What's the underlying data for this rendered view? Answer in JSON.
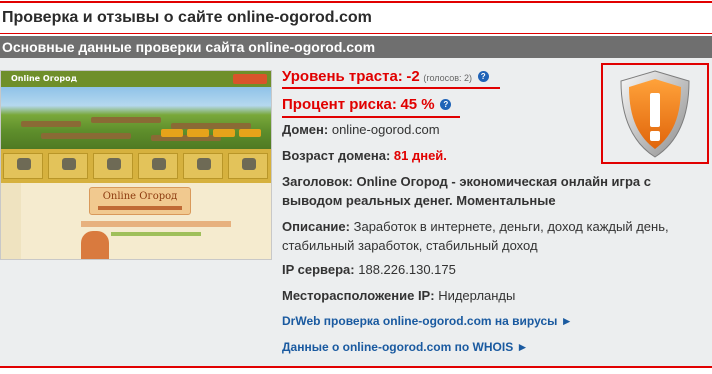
{
  "page": {
    "title": "Проверка и отзывы о сайте online-ogorod.com",
    "section_title": "Основные данные проверки сайта online-ogorod.com"
  },
  "thumbnail": {
    "logo_text": "Online Огород",
    "banner_text": "Online Огород"
  },
  "trust": {
    "label": "Уровень траста:",
    "value": "-2",
    "votes": "(голосов: 2)"
  },
  "risk": {
    "label": "Процент риска:",
    "value": "45 %"
  },
  "help_icon_glyph": "?",
  "domain": {
    "label": "Домен:",
    "value": "online-ogorod.com"
  },
  "age": {
    "label": "Возраст домена:",
    "value": "81 дней."
  },
  "heading": {
    "label": "Заголовок:",
    "value": "Online Огород - экономическая онлайн игра с выводом реальных денег. Моментальные"
  },
  "description": {
    "label": "Описание:",
    "value": "Заработок в интернете, деньги, доход каждый день, стабильный заработок, стабильный доход"
  },
  "ip": {
    "label": "IP сервера:",
    "value": "188.226.130.175"
  },
  "location": {
    "label": "Месторасположение IP:",
    "value": "Нидерланды"
  },
  "links": {
    "drweb": "DrWeb проверка online-ogorod.com на вирусы ►",
    "whois": "Данные о online-ogorod.com по WHOIS ►"
  },
  "colors": {
    "accent_red": "#e10000",
    "link_blue": "#1a5aa0",
    "section_bar": "#6f6f6f",
    "shield_orange": "#f07d12"
  },
  "icons": {
    "warning": "warning-shield-icon",
    "help": "help-icon"
  }
}
